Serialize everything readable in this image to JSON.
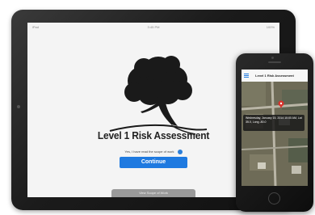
{
  "ipad": {
    "status_left": "iPad",
    "status_time": "3:45 PM",
    "status_right": "100%",
    "app_title": "Level 1 Risk Assessment",
    "confirm_text": "Yes, I have read the scope of work",
    "continue_label": "Continue",
    "scope_label": "View Scope of Work",
    "logo_icon": "tree-logo"
  },
  "iphone": {
    "nav_title": "Level 1 Risk Assessment",
    "callout_text": "Wednesday, January 15, 2014 10:00 AM, Lat 35.0, Long -80.0",
    "pin_icon": "map-pin-icon",
    "colors": {
      "accent": "#1f7ae0",
      "pin": "#d9312b"
    }
  }
}
